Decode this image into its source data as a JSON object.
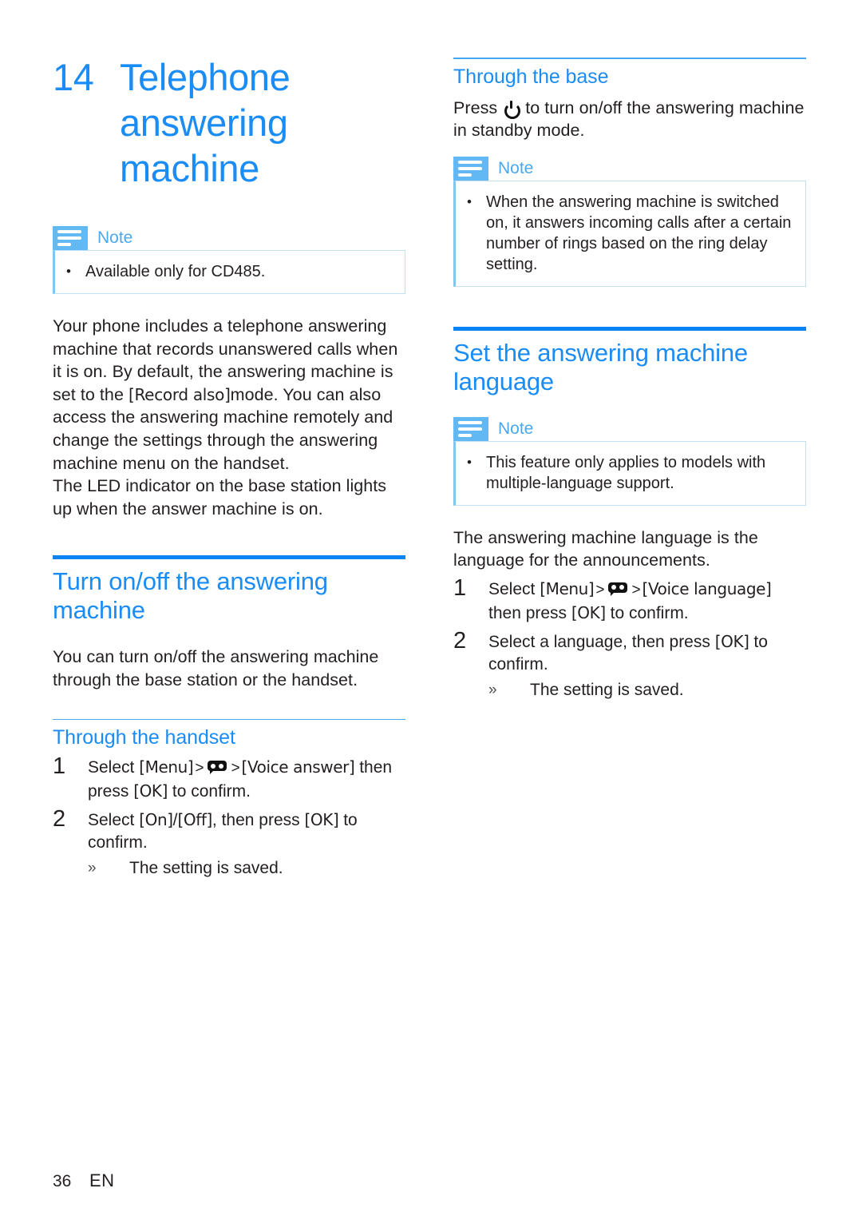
{
  "document": {
    "chapter_number": "14",
    "chapter_title": "Telephone answering machine",
    "footer": {
      "page_number": "36",
      "language_code": "EN"
    },
    "accent_color": "#1a8cf5",
    "note_icon_color": "#62b8f2",
    "note_border_color": "#bfe0f7"
  },
  "left_column": {
    "note": {
      "label": "Note",
      "icon": "note-lines-icon",
      "items": [
        "Available only for CD485."
      ]
    },
    "intro_paragraph_1_a": "Your phone includes a telephone answering machine that records unanswered calls when it is on. By default, the answering machine is set to the ",
    "intro_paragraph_1_token": "[Record also]",
    "intro_paragraph_1_b": "mode. You can also access the answering machine remotely and change the settings through the answering machine menu on the handset.",
    "intro_paragraph_2": "The LED indicator on the base station lights up when the answer machine is on.",
    "section_heading": "Turn on/off the answering machine",
    "section_paragraph": "You can turn on/off the answering machine through the base station or the handset.",
    "subsection_heading": "Through the handset",
    "steps": [
      {
        "number": "1",
        "prefix": "Select ",
        "token_1": "[Menu]",
        "sep_1": ">",
        "icon": "answering-machine-icon",
        "sep_2": ">",
        "token_2": "[Voice answer]",
        "suffix_a": " then press ",
        "token_3": "[OK]",
        "suffix_b": " to confirm."
      },
      {
        "number": "2",
        "prefix": "Select ",
        "token_1": "[On]",
        "sep_1": "/",
        "token_2": "[Off]",
        "suffix_a": ", then press ",
        "token_3": "[OK]",
        "suffix_b": " to confirm."
      }
    ],
    "result_marker": "»",
    "result_text": "The setting is saved."
  },
  "right_column": {
    "subsection_heading": "Through the base",
    "base_paragraph_a": "Press ",
    "base_icon": "power-icon",
    "base_paragraph_b": " to turn on/off the answering machine in standby mode.",
    "note_1": {
      "label": "Note",
      "icon": "note-lines-icon",
      "items": [
        "When the answering machine is switched on, it answers incoming calls after a certain number of rings based on the ring delay setting."
      ]
    },
    "section_heading": "Set the answering machine language",
    "note_2": {
      "label": "Note",
      "icon": "note-lines-icon",
      "items": [
        "This feature only applies to models with multiple-language support."
      ]
    },
    "section_paragraph": "The answering machine language is the language for the announcements.",
    "steps": [
      {
        "number": "1",
        "prefix": "Select ",
        "token_1": "[Menu]",
        "sep_1": ">",
        "icon": "answering-machine-icon",
        "sep_2": ">",
        "token_2": "[Voice language]",
        "suffix_a": " then press ",
        "token_3": "[OK]",
        "suffix_b": " to confirm."
      },
      {
        "number": "2",
        "prefix": "Select a language, then press ",
        "token_3": "[OK]",
        "suffix_b": " to confirm."
      }
    ],
    "result_marker": "»",
    "result_text": "The setting is saved."
  }
}
